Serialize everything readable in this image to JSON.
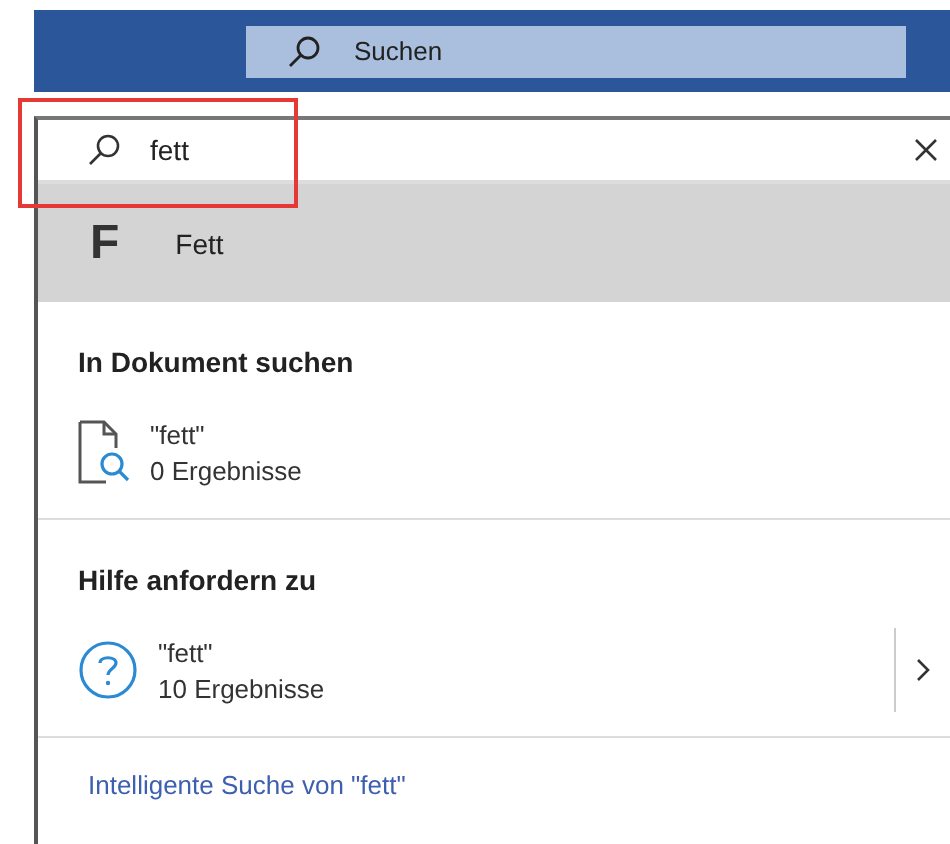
{
  "ribbon": {
    "search": {
      "placeholder": "Suchen"
    }
  },
  "search": {
    "value": "fett"
  },
  "suggestions": [
    {
      "letter": "F",
      "label": "Fett",
      "selected": true
    }
  ],
  "sections": [
    {
      "heading": "In Dokument suchen",
      "items": [
        {
          "kind": "document",
          "title": "\"fett\"",
          "subtitle": "0 Ergebnisse",
          "expandable": false
        }
      ]
    },
    {
      "heading": "Hilfe anfordern zu",
      "items": [
        {
          "kind": "help",
          "title": "\"fett\"",
          "subtitle": "10 Ergebnisse",
          "expandable": true
        }
      ]
    }
  ],
  "smart_search": {
    "link": "Intelligente Suche von \"fett\""
  }
}
